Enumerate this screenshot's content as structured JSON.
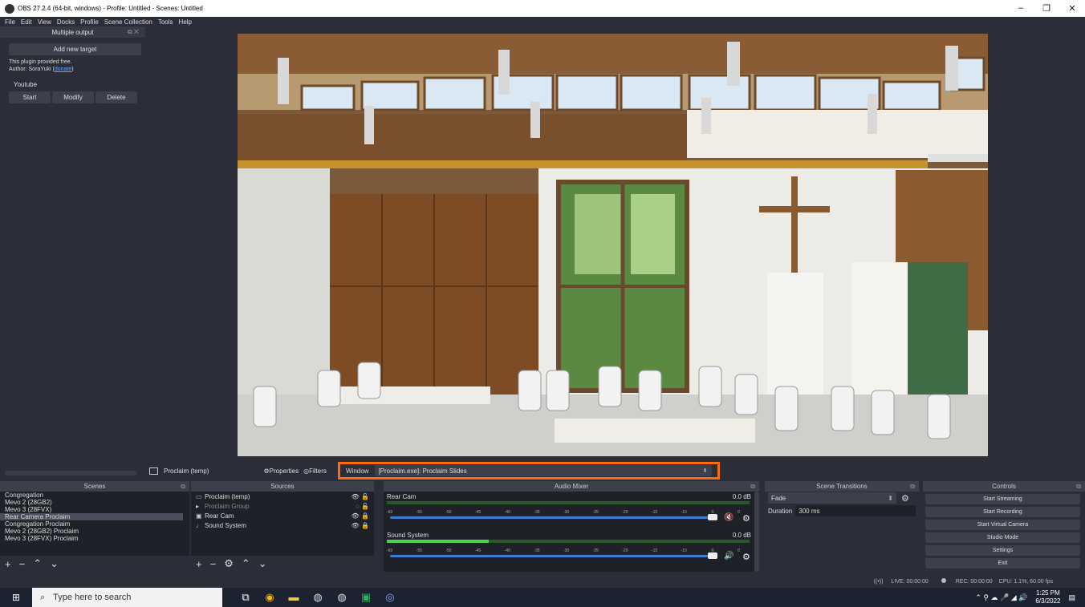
{
  "window": {
    "title": "OBS 27.2.4 (64-bit, windows) - Profile: Untitled - Scenes: Untitled",
    "minimize": "–",
    "restore": "❐",
    "close": "✕"
  },
  "menu": [
    "File",
    "Edit",
    "View",
    "Docks",
    "Profile",
    "Scene Collection",
    "Tools",
    "Help"
  ],
  "multiple_output": {
    "title": "Multiple output",
    "add_target": "Add new target",
    "info_line1": "This plugin provided free.",
    "info_author": "Author: SoraYuki (",
    "donate": "donate",
    "info_close": ")",
    "target_name": "Youtube",
    "start": "Start",
    "modify": "Modify",
    "delete": "Delete"
  },
  "source_toolbar": {
    "selected_source": "Proclaim (temp)",
    "properties": "Properties",
    "filters": "Filters",
    "window_label": "Window",
    "window_value": "[Proclaim.exe]: Proclaim Slides"
  },
  "scenes": {
    "title": "Scenes",
    "items": [
      "Congregation",
      "Mevo 2 (28GB2)",
      "Mevo 3 (28FVX)",
      "Rear Camera Proclaim",
      "Congregation Proclaim",
      "Mevo 2 (28GB2) Proclaim",
      "Mevo 3 (28FVX) Proclaim"
    ],
    "selected_index": 3
  },
  "sources": {
    "title": "Sources",
    "items": [
      {
        "name": "Proclaim (temp)",
        "icon": "window-icon"
      },
      {
        "name": "Proclaim Group",
        "icon": "folder-icon"
      },
      {
        "name": "Rear Cam",
        "icon": "camera-icon"
      },
      {
        "name": "Sound System",
        "icon": "mic-icon"
      }
    ]
  },
  "audio_mixer": {
    "title": "Audio Mixer",
    "tracks": [
      {
        "name": "Rear Cam",
        "db": "0.0 dB",
        "level": 0.0,
        "muted": true
      },
      {
        "name": "Sound System",
        "db": "0.0 dB",
        "level": 0.28,
        "muted": false
      }
    ],
    "ticks": [
      "-60",
      "-55",
      "-50",
      "-45",
      "-40",
      "-35",
      "-30",
      "-25",
      "-20",
      "-15",
      "-10",
      "-5",
      "0"
    ]
  },
  "scene_transitions": {
    "title": "Scene Transitions",
    "transition": "Fade",
    "duration_label": "Duration",
    "duration_value": "300 ms"
  },
  "controls": {
    "title": "Controls",
    "buttons": [
      "Start Streaming",
      "Start Recording",
      "Start Virtual Camera",
      "Studio Mode",
      "Settings",
      "Exit"
    ]
  },
  "status": {
    "live": "LIVE: 00:00:00",
    "rec": "REC: 00:00:00",
    "cpu": "CPU: 1.1%, 60.00 fps"
  },
  "taskbar": {
    "search_placeholder": "Type here to search",
    "time": "1:25 PM",
    "date": "6/3/2022"
  }
}
